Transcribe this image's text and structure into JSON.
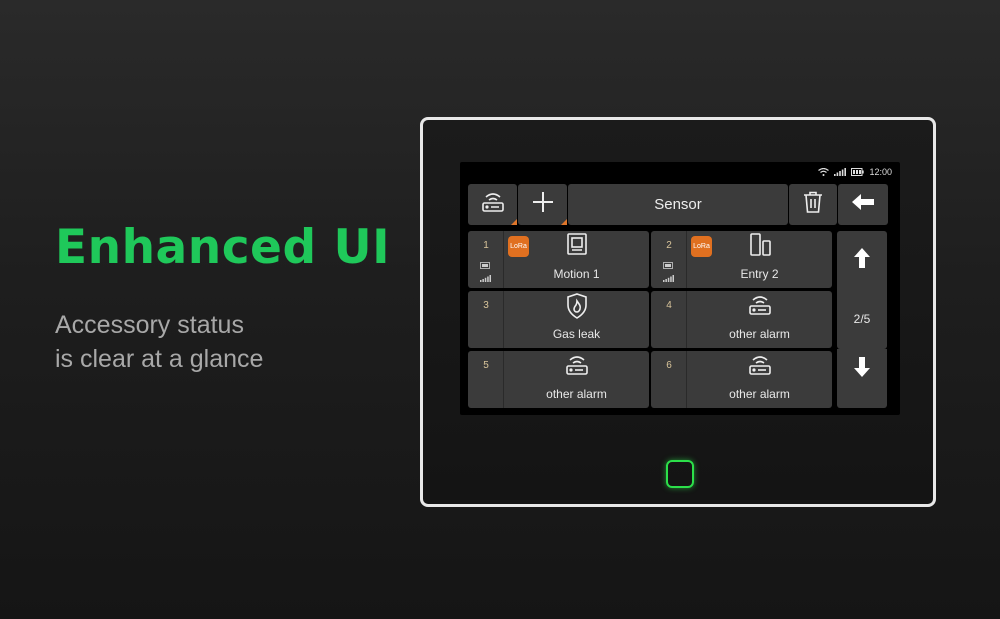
{
  "promo": {
    "headline": "Enhanced UI",
    "subtext_line1": "Accessory status",
    "subtext_line2": "is clear at a glance",
    "accent_color": "#1fc85a"
  },
  "panel": {
    "status_bar": {
      "time": "12:00",
      "icons": [
        "wifi-icon",
        "signal-icon",
        "battery-icon"
      ]
    },
    "toolbar": {
      "left_icon": "router-icon",
      "add_icon": "plus-icon",
      "title": "Sensor",
      "delete_icon": "trash-icon",
      "back_icon": "back-arrow-icon"
    },
    "page_indicator": "2/5",
    "devices": [
      {
        "index": "1",
        "label": "Motion 1",
        "badge": "LoRa",
        "icon": "motion-sensor-icon",
        "has_status": true
      },
      {
        "index": "2",
        "label": "Entry 2",
        "badge": "LoRa",
        "icon": "door-contact-icon",
        "has_status": true
      },
      {
        "index": "3",
        "label": "Gas leak",
        "badge": "",
        "icon": "gas-shield-icon",
        "has_status": false
      },
      {
        "index": "4",
        "label": "other alarm",
        "badge": "",
        "icon": "router-icon",
        "has_status": false
      },
      {
        "index": "5",
        "label": "other alarm",
        "badge": "",
        "icon": "router-icon",
        "has_status": false
      },
      {
        "index": "6",
        "label": "other alarm",
        "badge": "",
        "icon": "router-icon",
        "has_status": false
      }
    ],
    "home_button_color": "#2ce04a",
    "badge_color": "#e07020"
  }
}
